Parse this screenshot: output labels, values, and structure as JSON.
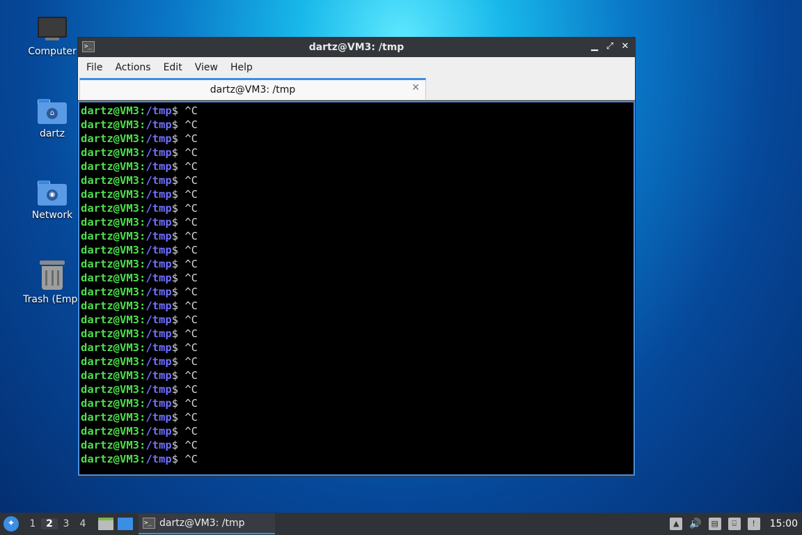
{
  "desktop": {
    "icons": [
      {
        "label": "Computer"
      },
      {
        "label": "dartz"
      },
      {
        "label": "Network"
      },
      {
        "label": "Trash (Empt"
      }
    ]
  },
  "window": {
    "title": "dartz@VM3: /tmp",
    "controls": {
      "minimize": "▁",
      "restore": "⤢",
      "close": "✕"
    },
    "menu": [
      "File",
      "Actions",
      "Edit",
      "View",
      "Help"
    ],
    "tab": {
      "label": "dartz@VM3: /tmp",
      "close": "✕"
    },
    "terminal": {
      "user_host": "dartz@VM3:",
      "path": "/tmp",
      "suffix": "$ ^C",
      "line_count": 26
    }
  },
  "taskbar": {
    "workspaces": [
      "1",
      "2",
      "3",
      "4"
    ],
    "active_workspace": "2",
    "task_label": "dartz@VM3: /tmp",
    "clock": "15:00",
    "tray_icons": [
      "up-arrow-icon",
      "volume-icon",
      "clipboard-icon",
      "network-icon",
      "update-notifier-icon"
    ]
  },
  "colors": {
    "prompt_user": "#4ee04e",
    "prompt_path": "#7070ff",
    "accent": "#3a8ee6"
  }
}
